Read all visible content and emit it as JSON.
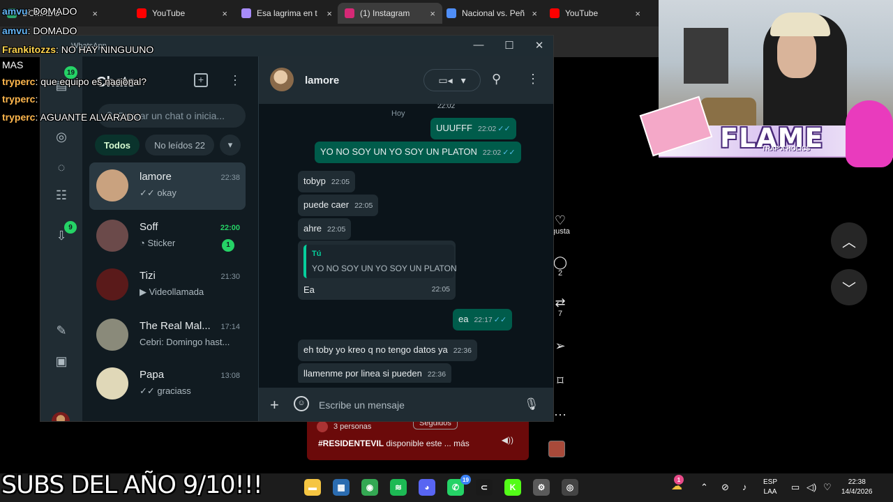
{
  "browser": {
    "tabs": [
      {
        "label": "DOMADO",
        "color": "#2aa36b",
        "active": false
      },
      {
        "label": "YouTube",
        "color": "#ff0000",
        "active": false
      },
      {
        "label": "Esa lagrima en t",
        "color": "#a78bfa",
        "active": false
      },
      {
        "label": "(1) Instagram",
        "color": "#d62976",
        "active": true
      },
      {
        "label": "Nacional vs. Peñ",
        "color": "#4f8ef7",
        "active": false
      },
      {
        "label": "YouTube",
        "color": "#ff0000",
        "active": false
      }
    ],
    "close_glyph": "×"
  },
  "instagram": {
    "actions": [
      {
        "icon": "heart-icon",
        "glyph": "♡",
        "label": "gusta"
      },
      {
        "icon": "comment-icon",
        "glyph": "◯",
        "label": "2"
      },
      {
        "icon": "repost-icon",
        "glyph": "⇄",
        "label": "7"
      },
      {
        "icon": "share-icon",
        "glyph": "➢",
        "label": ""
      },
      {
        "icon": "bookmark-icon",
        "glyph": "⌑",
        "label": ""
      },
      {
        "icon": "more-icon",
        "glyph": "···",
        "label": ""
      }
    ],
    "nav_up_glyph": "︿",
    "nav_down_glyph": "﹀",
    "reel": {
      "people": "3 personas",
      "following": "Seguidos",
      "hashtag": "#RESIDENTEVIL",
      "caption": "disponible este ...",
      "more": "más"
    }
  },
  "whatsapp": {
    "window_title": "WhatsApp",
    "window_controls": {
      "minimize": "—",
      "maximize": "☐",
      "close": "✕"
    },
    "rail": {
      "chats_badge": "19",
      "downloads_badge": "9"
    },
    "list": {
      "title": "Chats",
      "search_placeholder": "Buscar un chat o inicia...",
      "filters": [
        {
          "label": "Todos",
          "active": true
        },
        {
          "label": "No leídos 22",
          "active": false
        }
      ],
      "chats": [
        {
          "name": "lamore",
          "time": "22:38",
          "last": "✓✓ okay",
          "badge": "",
          "selected": true,
          "avatar": "#c9a27f"
        },
        {
          "name": "Soff",
          "time": "22:00",
          "last": "◔ Sticker",
          "badge": "1",
          "selected": false,
          "avatar": "#6b4a4a"
        },
        {
          "name": "Tizi",
          "time": "21:30",
          "last": "▶ Videollamada",
          "badge": "",
          "selected": false,
          "avatar": "#5a1a1a"
        },
        {
          "name": "The Real Mal...",
          "time": "17:14",
          "last": "Cebri: Domingo hast...",
          "badge": "",
          "selected": false,
          "avatar": "#8a8a7a"
        },
        {
          "name": "Papa",
          "time": "13:08",
          "last": "✓✓ graciass",
          "badge": "",
          "selected": false,
          "avatar": "#e0d8b8"
        }
      ]
    },
    "conversation": {
      "contact": "lamore",
      "day": "Hoy",
      "first_time": "22:02",
      "messages": [
        {
          "dir": "out",
          "text": "UUUFFF",
          "time": "22:02",
          "read": true
        },
        {
          "dir": "out",
          "text": "YO NO SOY UN YO SOY UN PLATON",
          "time": "22:02",
          "read": true
        },
        {
          "dir": "in",
          "text": "tobyp",
          "time": "22:05"
        },
        {
          "dir": "in",
          "text": "puede caer",
          "time": "22:05"
        },
        {
          "dir": "in",
          "text": "ahre",
          "time": "22:05"
        },
        {
          "dir": "in",
          "text": "Ea",
          "time": "22:05",
          "quote_author": "Tú",
          "quote_text": "YO NO SOY UN YO SOY UN PLATON"
        },
        {
          "dir": "out",
          "text": "ea",
          "time": "22:17",
          "read": true
        },
        {
          "dir": "in",
          "text": "eh toby yo kreo q no tengo datos ya",
          "time": "22:36"
        },
        {
          "dir": "in",
          "text": "llamenme por linea si pueden",
          "time": "22:36"
        }
      ],
      "composer_placeholder": "Escribe un mensaje"
    }
  },
  "stream_chat": [
    {
      "user": "amvu",
      "color": "#64b5f6",
      "text": "DOMADO"
    },
    {
      "user": "amvu",
      "color": "#64b5f6",
      "text": "DOMADO"
    },
    {
      "user": "Frankitozzs",
      "color": "#ffd54f",
      "text": "NO HAY NINGUUNO"
    },
    {
      "user": "",
      "color": "#ffffff",
      "text": "MAS"
    },
    {
      "user": "tryperc",
      "color": "#ffb74d",
      "text": "que equipo es nacional?"
    },
    {
      "user": "tryperc",
      "color": "#ffb74d",
      "text": ""
    },
    {
      "user": "tryperc",
      "color": "#ffb74d",
      "text": "AGUANTE ALVARADO"
    }
  ],
  "webcam": {
    "logo": "FLAME",
    "logo_sub": "TRAP'A'HOLICS"
  },
  "taskbar": {
    "apps": [
      {
        "icon": "explorer-icon",
        "color": "#f5c542",
        "glyph": "▬"
      },
      {
        "icon": "store-icon",
        "color": "#2b6cb0",
        "glyph": "▦"
      },
      {
        "icon": "chrome-icon",
        "color": "#34a853",
        "glyph": "◉"
      },
      {
        "icon": "spotify-icon",
        "color": "#1db954",
        "glyph": "≋"
      },
      {
        "icon": "discord-icon",
        "color": "#5865f2",
        "glyph": "◕"
      },
      {
        "icon": "whatsapp-icon",
        "color": "#25d366",
        "glyph": "✆"
      },
      {
        "icon": "capcut-icon",
        "color": "#1a1a1a",
        "glyph": "⊂"
      },
      {
        "icon": "kick-icon",
        "color": "#53fc18",
        "glyph": "K"
      },
      {
        "icon": "settings-icon",
        "color": "#5a5a5a",
        "glyph": "⚙"
      },
      {
        "icon": "opera-icon",
        "color": "#444444",
        "glyph": "◎"
      }
    ],
    "whatsapp_badge": "19",
    "language": "ESP",
    "layout": "LAA",
    "time": "22:38",
    "date": "14/4/2026",
    "weather_badge": "1"
  },
  "subs_banner": "SUBS DEL AÑO 9/10!!!"
}
